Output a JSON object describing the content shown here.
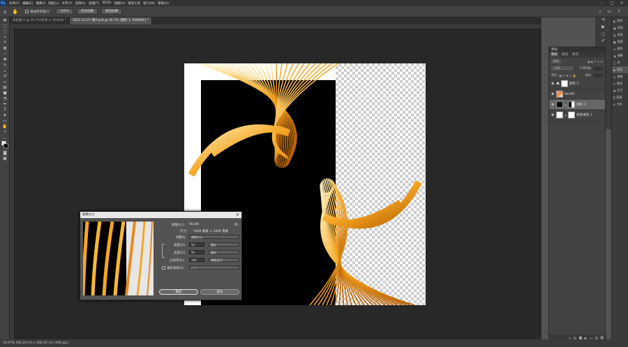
{
  "app": {
    "logo": "Ps"
  },
  "menu": [
    "文件(F)",
    "编辑(E)",
    "图像(I)",
    "图层(L)",
    "文字(Y)",
    "选择(S)",
    "滤镜(T)",
    "3D(D)",
    "视图(V)",
    "增效工具",
    "窗口(W)",
    "帮助(H)"
  ],
  "options_bar": {
    "scroll_all": "滚动所有窗口",
    "zoom": "100%",
    "fit_screen": "适合屏幕",
    "fill_screen": "填充屏幕"
  },
  "tabs": [
    "未标题-1 @ 16.7%(形状 4, RGB/8) *",
    "2021-12-27-银2.psd @ 16.7% (图形 1, RGB/8#) *"
  ],
  "layers_panel": {
    "title": "图层",
    "tabs": [
      "图层",
      "通道",
      "路径"
    ],
    "kind_label": "类型",
    "mode": "正常",
    "opacity_label": "不透明度:",
    "lock_label": "锁定:",
    "fill_label": "填充:",
    "layers": [
      {
        "name": "图形 2",
        "selected": false
      },
      {
        "name": "Ibm84",
        "selected": false
      },
      {
        "name": "图形 1",
        "selected": true
      },
      {
        "name": "颜色填充 1",
        "selected": false
      }
    ]
  },
  "right_panel": [
    "颜色",
    "色板",
    "渐变",
    "图案",
    "属性",
    "调整",
    "库",
    "图层",
    "通道",
    "路径",
    "学习",
    "段落",
    "字符"
  ],
  "status": {
    "text": "16.67%   300.24 cm x 300.24 cm (300 ppi)"
  },
  "dialog": {
    "title": "图像大小",
    "image_size_label": "图像大小:",
    "image_size_value": "99.8M",
    "dimensions_label": "尺寸:",
    "dimensions_value": "5906 像素 × 5906 像素",
    "fit_to_label": "调整为:",
    "fit_to_value": "原稿大小",
    "width_label": "宽度(D):",
    "width_value": "50",
    "width_unit": "厘米",
    "height_label": "高度(G):",
    "height_value": "50",
    "height_unit": "厘米",
    "resolution_label": "分辨率(R):",
    "resolution_value": "300",
    "resolution_unit": "像素/英寸",
    "resample_label": "重新采样(S):",
    "resample_value": "自动",
    "ok": "确定",
    "cancel": "复位"
  }
}
